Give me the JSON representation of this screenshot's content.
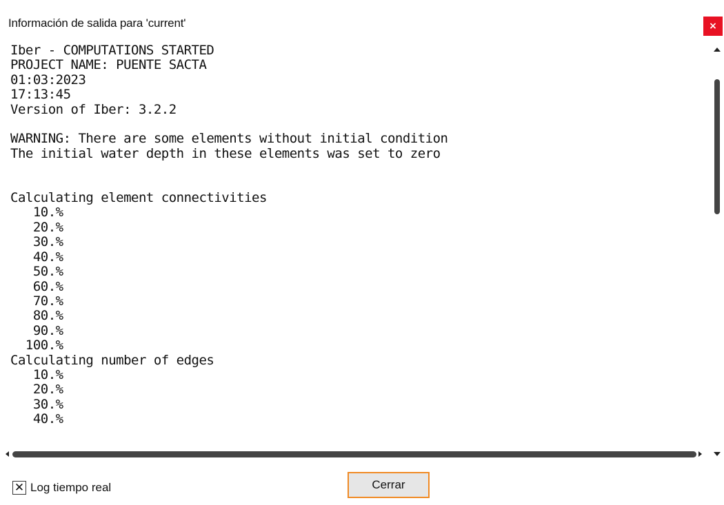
{
  "window": {
    "title": "Información de salida para 'current'",
    "close_glyph": "×",
    "close_icon": "close-icon"
  },
  "log": {
    "lines": [
      "Iber - COMPUTATIONS STARTED",
      "PROJECT NAME: PUENTE SACTA",
      "01:03:2023",
      "17:13:45",
      "Version of Iber: 3.2.2",
      "",
      "WARNING: There are some elements without initial condition",
      "The initial water depth in these elements was set to zero",
      "",
      "",
      "Calculating element connectivities",
      "   10.%",
      "   20.%",
      "   30.%",
      "   40.%",
      "   50.%",
      "   60.%",
      "   70.%",
      "   80.%",
      "   90.%",
      "  100.%",
      "Calculating number of edges",
      "   10.%",
      "   20.%",
      "   30.%",
      "   40.%"
    ]
  },
  "controls": {
    "checkbox_mark": "✕",
    "checkbox_checked": true,
    "checkbox_label": "Log tiempo real",
    "close_button_label": "Cerrar"
  },
  "colors": {
    "close_button_bg": "#e81123",
    "focus_border": "#f08a24",
    "button_bg": "#e6e6e6"
  }
}
